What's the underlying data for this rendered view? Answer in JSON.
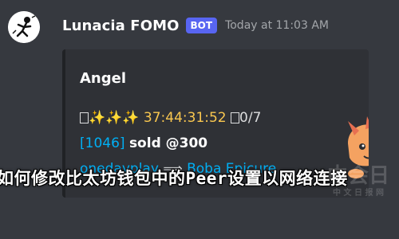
{
  "message": {
    "author": "Lunacia FOMO",
    "badge": "BOT",
    "timestamp": "Today at 11:03 AM"
  },
  "embed": {
    "title": "Angel",
    "line1_text": "✨✨✨ 37:44:31:52 ",
    "line1_suffix": "0/7",
    "line2_prefix": "[1046] ",
    "line2_bold": "sold",
    "line2_suffix": " @300",
    "line3_from": "onedayplay",
    "line3_arrow": "⟹",
    "line3_to": "Boba Epicure"
  },
  "overlay_text": "如何修改比太坊钱包中的Peer设置以网络连接",
  "watermark": {
    "line1": "中会日",
    "line2": "中 文 日 报 网"
  },
  "colors": {
    "background": "#36393f",
    "embed_bg": "#2f3136",
    "badge": "#5865f2",
    "link": "#00aff4"
  },
  "icons": {
    "avatar": "stick-figure-avatar",
    "thumbnail": "winged-creature-art"
  }
}
